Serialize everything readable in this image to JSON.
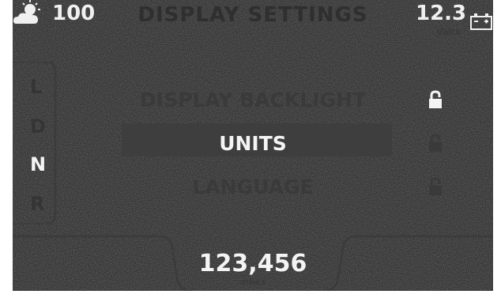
{
  "header": {
    "temperature": "100",
    "title": "DISPLAY SETTINGS",
    "voltage": "12.3",
    "voltage_unit": "Volts",
    "weather_icon": "sun-cloud-icon",
    "battery_icon": "battery-icon"
  },
  "gear_selector": {
    "gears": [
      "L",
      "D",
      "N",
      "R"
    ],
    "active": "N"
  },
  "menu": {
    "items": [
      {
        "label": "DISPLAY BACKLIGHT",
        "locked": true,
        "state": "dim"
      },
      {
        "label": "UNITS",
        "locked": true,
        "state": "selected"
      },
      {
        "label": "LANGUAGE",
        "locked": true,
        "state": "dim"
      }
    ]
  },
  "odometer": {
    "value": "123,456",
    "unit": "miles"
  },
  "colors": {
    "background": "#191919",
    "text_bright": "#f4f4f4",
    "text_dim": "#3a3a3a",
    "highlight": "#3e3e3e"
  }
}
